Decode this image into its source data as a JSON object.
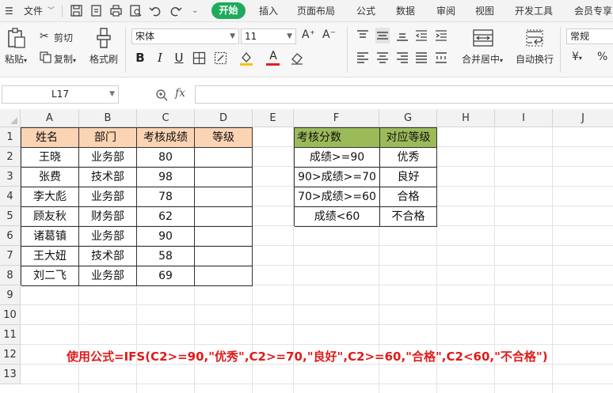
{
  "menubar": {
    "file_label": "文件",
    "tabs": [
      "开始",
      "插入",
      "页面布局",
      "公式",
      "数据",
      "审阅",
      "视图",
      "开发工具",
      "会员专享"
    ]
  },
  "ribbon": {
    "paste_label": "粘贴",
    "cut_label": "剪切",
    "copy_label": "复制",
    "format_painter_label": "格式刷",
    "font_name": "宋体",
    "font_size": "11",
    "font_grow": "A⁺",
    "font_shrink": "A⁻",
    "merge_center_label": "合并居中",
    "wrap_text_label": "自动换行",
    "number_format": "常规",
    "currency_symbol": "¥",
    "font_color": "#e02020",
    "accent_color": "#1fab5b"
  },
  "formula_bar": {
    "name_box": "L17",
    "fx_label": "fx",
    "formula": ""
  },
  "sheet": {
    "columns": [
      "A",
      "B",
      "C",
      "D",
      "E",
      "F",
      "G",
      "H",
      "I",
      "J"
    ],
    "rows": [
      "1",
      "2",
      "3",
      "4",
      "5",
      "6",
      "7",
      "8",
      "9",
      "10",
      "11",
      "12",
      "13"
    ],
    "table1": {
      "headers": [
        "姓名",
        "部门",
        "考核成绩",
        "等级"
      ],
      "rows": [
        [
          "王晓",
          "业务部",
          "80",
          ""
        ],
        [
          "张费",
          "技术部",
          "98",
          ""
        ],
        [
          "李大彪",
          "业务部",
          "78",
          ""
        ],
        [
          "顾友秋",
          "财务部",
          "62",
          ""
        ],
        [
          "诸葛镇",
          "业务部",
          "90",
          ""
        ],
        [
          "王大妞",
          "技术部",
          "58",
          ""
        ],
        [
          "刘二飞",
          "业务部",
          "69",
          ""
        ]
      ]
    },
    "table2": {
      "headers": [
        "考核分数",
        "对应等级"
      ],
      "rows": [
        [
          "成绩>=90",
          "优秀"
        ],
        [
          "90>成绩>=70",
          "良好"
        ],
        [
          "70>成绩>=60",
          "合格"
        ],
        [
          "成绩<60",
          "不合格"
        ]
      ]
    },
    "note": "使用公式=IFS(C2>=90,\"优秀\",C2>=70,\"良好\",C2>=60,\"合格\",C2<60,\"不合格\")"
  }
}
